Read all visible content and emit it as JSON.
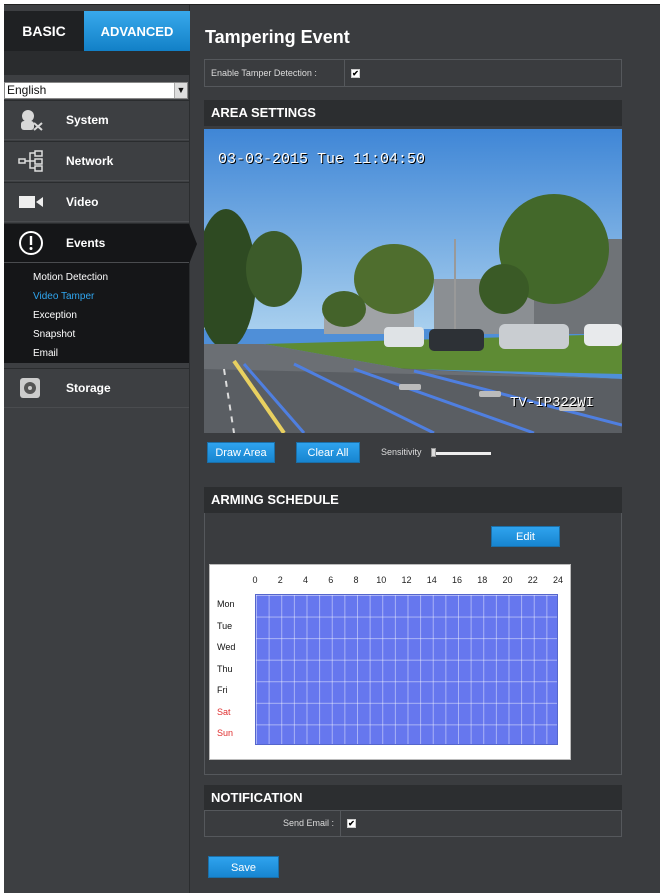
{
  "tabs": {
    "basic": "BASIC",
    "advanced": "ADVANCED"
  },
  "language": {
    "selected": "English"
  },
  "sidebar": {
    "items": [
      {
        "label": "System",
        "icon": "system-icon"
      },
      {
        "label": "Network",
        "icon": "network-icon"
      },
      {
        "label": "Video",
        "icon": "video-camera-icon"
      },
      {
        "label": "Events",
        "icon": "exclamation-icon"
      },
      {
        "label": "Storage",
        "icon": "storage-icon"
      }
    ],
    "events_submenu": [
      "Motion Detection",
      "Video Tamper",
      "Exception",
      "Snapshot",
      "Email"
    ]
  },
  "page": {
    "title": "Tampering Event"
  },
  "enable": {
    "label": "Enable Tamper Detection :",
    "checked": true
  },
  "area_settings": {
    "title": "AREA SETTINGS",
    "osd_time": "03-03-2015 Tue 11:04:50",
    "osd_name": "TV-IP322WI",
    "draw_area": "Draw Area",
    "clear_all": "Clear All",
    "sensitivity_label": "Sensitivity",
    "sensitivity_level": 0
  },
  "arming_schedule": {
    "title": "ARMING SCHEDULE",
    "edit": "Edit",
    "hours": [
      "0",
      "2",
      "4",
      "6",
      "8",
      "10",
      "12",
      "14",
      "16",
      "18",
      "20",
      "22",
      "24"
    ],
    "days": [
      "Mon",
      "Tue",
      "Wed",
      "Thu",
      "Fri",
      "Sat",
      "Sun"
    ],
    "weekend_color": "#e03030",
    "armed_color": "#6677ee"
  },
  "notification": {
    "title": "NOTIFICATION",
    "send_email_label": "Send Email :",
    "checked": true
  },
  "save": "Save",
  "colors": {
    "accent": "#1e8fdc",
    "sidebar_bg": "#3d3f42",
    "active_bg": "#151618"
  }
}
